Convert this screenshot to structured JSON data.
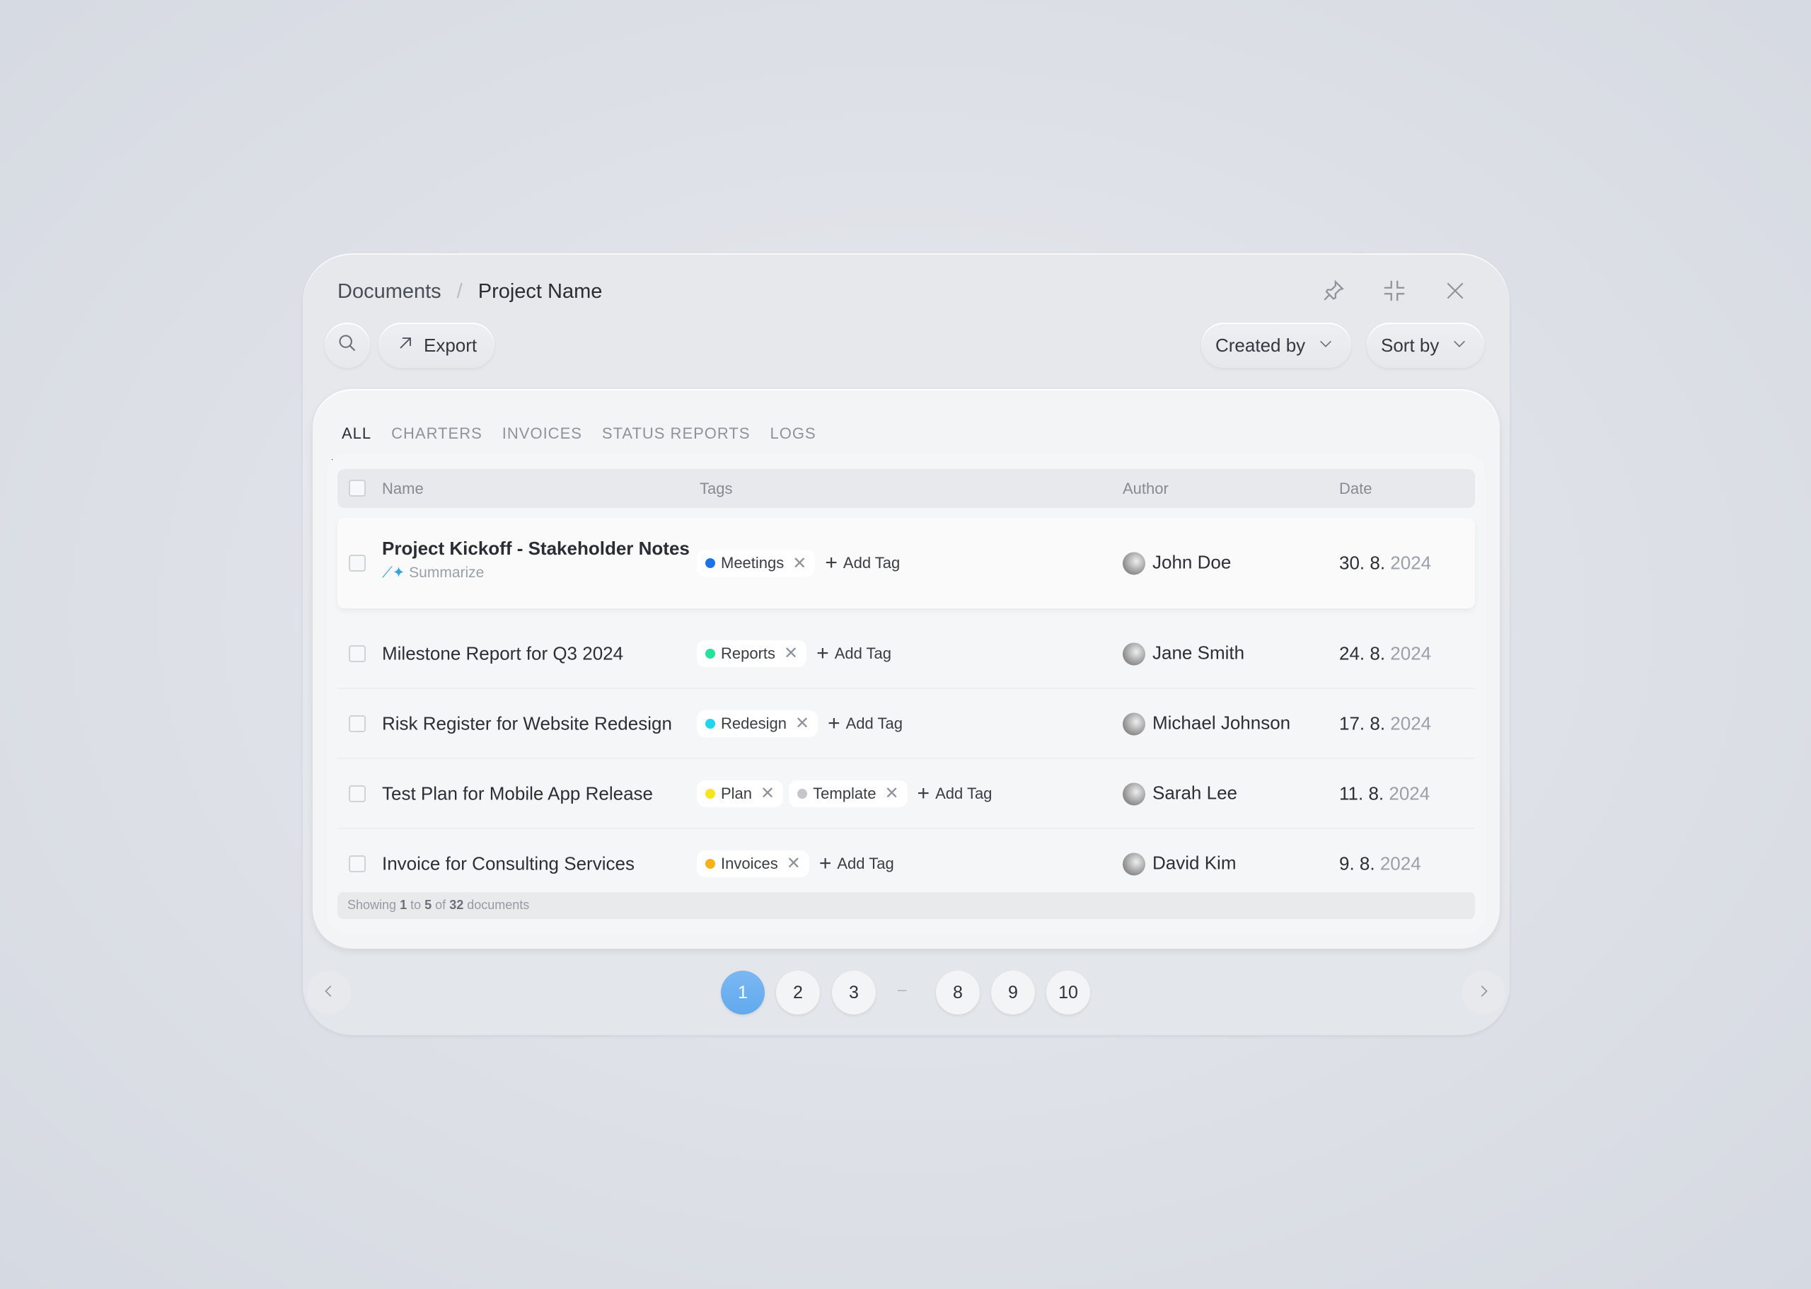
{
  "breadcrumb": {
    "root": "Documents",
    "separator": "/",
    "current": "Project Name"
  },
  "toolbar": {
    "export": "Export",
    "created_by": "Created by",
    "sort_by": "Sort by"
  },
  "tabs": [
    {
      "label": "ALL",
      "active": true
    },
    {
      "label": "CHARTERS"
    },
    {
      "label": "INVOICES"
    },
    {
      "label": "STATUS REPORTS"
    },
    {
      "label": "LOGS"
    }
  ],
  "table": {
    "headers": {
      "name": "Name",
      "tags": "Tags",
      "author": "Author",
      "date": "Date"
    },
    "add_tag": "Add Tag",
    "summarize": "Summarize",
    "rows": [
      {
        "name": "Project Kickoff - Stakeholder Notes",
        "tags": [
          {
            "label": "Meetings",
            "color": "#1a73e8"
          }
        ],
        "author": "John Doe",
        "day": "30. 8.",
        "year": "2024"
      },
      {
        "name": "Milestone Report for Q3 2024",
        "tags": [
          {
            "label": "Reports",
            "color": "#22e39a"
          }
        ],
        "author": "Jane Smith",
        "day": "24. 8.",
        "year": "2024"
      },
      {
        "name": "Risk Register for Website Redesign",
        "tags": [
          {
            "label": "Redesign",
            "color": "#1fd6f0"
          }
        ],
        "author": "Michael Johnson",
        "day": "17. 8.",
        "year": "2024"
      },
      {
        "name": "Test Plan for Mobile App Release",
        "tags": [
          {
            "label": "Plan",
            "color": "#f5e61c"
          },
          {
            "label": "Template",
            "color": "#c4c6ca"
          }
        ],
        "author": "Sarah Lee",
        "day": "11. 8.",
        "year": "2024"
      },
      {
        "name": "Invoice for Consulting Services",
        "tags": [
          {
            "label": "Invoices",
            "color": "#f5b316"
          }
        ],
        "author": "David Kim",
        "day": "9. 8.",
        "year": "2024"
      }
    ]
  },
  "footer": {
    "prefix": "Showing",
    "from": "1",
    "to_word": "to",
    "to": "5",
    "of_word": "of",
    "total": "32",
    "suffix": "documents"
  },
  "pagination": {
    "pages": [
      "1",
      "2",
      "3",
      "8",
      "9",
      "10"
    ],
    "ellipsis": "–",
    "current": "1"
  },
  "colors": {
    "accent": "#6aaef0"
  }
}
